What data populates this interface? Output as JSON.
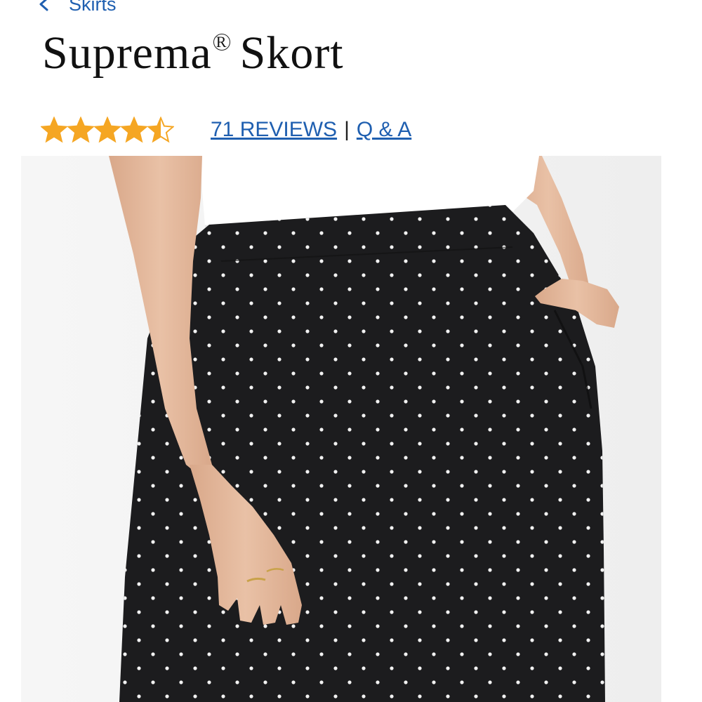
{
  "breadcrumb": {
    "label": "Skirts",
    "icon": "chevron-left-icon"
  },
  "product": {
    "title": "Suprema",
    "registered_mark": "R",
    "title_suffix": "Skort",
    "rating": 4.5,
    "rating_max": 5,
    "reviews_label": "71 REVIEWS",
    "separator": "|",
    "qa_label": "Q & A"
  },
  "colors": {
    "link": "#1f5fb0",
    "star": "#f5a623",
    "skirt": "#1c1c1e",
    "dot": "#f2f2f2",
    "skin": "#e3b79a",
    "shirt": "#ffffff",
    "backdrop": "#f4f4f4"
  }
}
